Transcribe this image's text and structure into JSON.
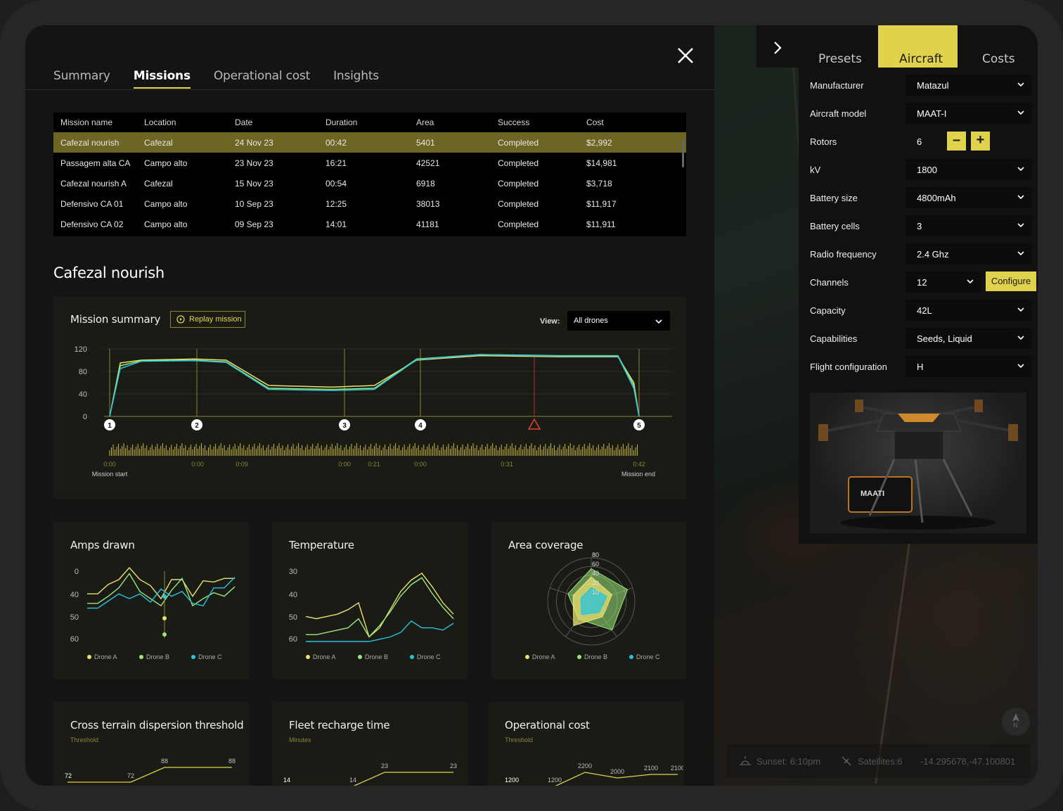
{
  "tabs": [
    "Summary",
    "Missions",
    "Operational cost",
    "Insights"
  ],
  "active_tab": "Missions",
  "table": {
    "headers": [
      "Mission name",
      "Location",
      "Date",
      "Duration",
      "Area",
      "Success",
      "Cost"
    ],
    "rows": [
      [
        "Cafezal nourish",
        "Cafezal",
        "24 Nov 23",
        "00:42",
        "5401",
        "Completed",
        "$2,992"
      ],
      [
        "Passagem alta CA",
        "Campo alto",
        "23 Nov 23",
        "16:21",
        "42521",
        "Completed",
        "$14,981"
      ],
      [
        "Cafezal nourish A",
        "Cafezal",
        "15 Nov 23",
        "00:54",
        "6918",
        "Completed",
        "$3,718"
      ],
      [
        "Defensivo CA 01",
        "Campo alto",
        "10 Sep 23",
        "12:25",
        "38013",
        "Completed",
        "$11,917"
      ],
      [
        "Defensivo CA 02",
        "Campo alto",
        "09 Sep 23",
        "14:01",
        "41181",
        "Completed",
        "$11,911"
      ]
    ]
  },
  "mission_title": "Cafezal nourish",
  "summary": {
    "title": "Mission summary",
    "replay_label": "Replay mission",
    "view_label": "View:",
    "view_value": "All drones",
    "time_labels": [
      "0:00",
      "0:00",
      "0:09",
      "0:00",
      "0:21",
      "0:00",
      "0:31",
      "0:42"
    ],
    "start_label": "Mission start",
    "end_label": "Mission end",
    "waypoints": [
      "1",
      "2",
      "3",
      "4",
      "5"
    ]
  },
  "cards": {
    "amps": "Amps drawn",
    "temperature": "Temperature",
    "area": "Area coverage",
    "cross": "Cross terrain dispersion threshold",
    "cross_sub": "Threshold",
    "fleet": "Fleet recharge time",
    "fleet_sub": "Minutes",
    "opcost": "Operational cost",
    "opcost_sub": "Threshold"
  },
  "legend": [
    "Drone A",
    "Drone B",
    "Drone C"
  ],
  "colors": {
    "accent": "#e0d24a",
    "droneA": "#e8e070",
    "droneB": "#9ae87a",
    "droneC": "#27c3e0",
    "selected_row": "#6d6524"
  },
  "chart_data": [
    {
      "type": "line",
      "title": "Mission summary",
      "ylim": [
        0,
        120
      ],
      "yticks": [
        0,
        40,
        80,
        120
      ],
      "x": [
        0,
        0.02,
        0.06,
        0.16,
        0.22,
        0.3,
        0.42,
        0.5,
        0.58,
        0.7,
        0.85,
        0.96,
        0.99,
        1.0
      ],
      "series": [
        {
          "name": "Drone A",
          "values": [
            0,
            95,
            100,
            102,
            100,
            55,
            52,
            55,
            100,
            108,
            106,
            106,
            60,
            0
          ]
        },
        {
          "name": "Drone B",
          "values": [
            0,
            90,
            99,
            100,
            97,
            50,
            48,
            50,
            102,
            110,
            108,
            108,
            55,
            0
          ]
        },
        {
          "name": "Drone C",
          "values": [
            0,
            85,
            98,
            99,
            96,
            48,
            46,
            48,
            101,
            110,
            107,
            107,
            50,
            0
          ]
        }
      ]
    },
    {
      "type": "line",
      "title": "Amps drawn",
      "ylim": [
        0,
        65
      ],
      "yticks": [
        0,
        40,
        50,
        60
      ],
      "series": [
        {
          "name": "Drone A",
          "values": [
            40,
            40,
            48,
            52,
            62,
            52,
            47,
            36,
            52,
            52,
            38,
            51,
            50,
            53,
            53
          ]
        },
        {
          "name": "Drone B",
          "values": [
            32,
            32,
            38,
            45,
            57,
            42,
            36,
            30,
            43,
            53,
            30,
            36,
            41,
            38,
            46
          ]
        },
        {
          "name": "Drone C",
          "values": [
            28,
            28,
            34,
            40,
            36,
            40,
            33,
            44,
            38,
            42,
            32,
            30,
            45,
            45,
            54
          ]
        }
      ]
    },
    {
      "type": "line",
      "title": "Temperature",
      "ylim": [
        28,
        62
      ],
      "yticks": [
        30,
        40,
        50,
        60
      ],
      "series": [
        {
          "name": "Drone A",
          "values": [
            39,
            38,
            39,
            40,
            42,
            45,
            30,
            34,
            42,
            50,
            55,
            58,
            52,
            45,
            40
          ]
        },
        {
          "name": "Drone B",
          "values": [
            31,
            31,
            32,
            33,
            34,
            38,
            30,
            35,
            41,
            48,
            53,
            56,
            49,
            43,
            38
          ]
        },
        {
          "name": "Drone C",
          "values": [
            28,
            28,
            28,
            28,
            28,
            28,
            28,
            29,
            30,
            32,
            37,
            34,
            34,
            33,
            36
          ]
        }
      ]
    },
    {
      "type": "radar",
      "title": "Area coverage",
      "rticks": [
        10,
        20,
        40,
        60,
        80
      ],
      "series": [
        {
          "name": "Drone A",
          "values": [
            45,
            40,
            35,
            55,
            35
          ]
        },
        {
          "name": "Drone B",
          "values": [
            60,
            70,
            65,
            40,
            45
          ]
        },
        {
          "name": "Drone C",
          "values": [
            25,
            30,
            25,
            30,
            20
          ]
        }
      ]
    },
    {
      "type": "line",
      "title": "Cross terrain dispersion threshold",
      "labels": [
        "72",
        "72",
        "88",
        "88"
      ],
      "values": [
        72,
        72,
        88,
        88
      ]
    },
    {
      "type": "line",
      "title": "Fleet recharge time",
      "labels": [
        "14",
        "14",
        "23",
        "23"
      ],
      "values": [
        14,
        14,
        23,
        23
      ]
    },
    {
      "type": "line",
      "title": "Operational cost",
      "labels": [
        "1200",
        "1200",
        "2200",
        "2000",
        "2100",
        "2100"
      ],
      "values": [
        1200,
        1200,
        2200,
        2000,
        2100,
        2100
      ]
    }
  ],
  "right_tabs": [
    "Presets",
    "Aircraft",
    "Costs"
  ],
  "right_active": "Aircraft",
  "aircraft": [
    {
      "label": "Manufacturer",
      "value": "Matazul"
    },
    {
      "label": "Aircraft model",
      "value": "MAAT-I"
    },
    {
      "label": "Rotors",
      "value": "6"
    },
    {
      "label": "kV",
      "value": "1800"
    },
    {
      "label": "Battery size",
      "value": "4800mAh"
    },
    {
      "label": "Battery cells",
      "value": "3"
    },
    {
      "label": "Radio frequency",
      "value": "2.4 Ghz"
    },
    {
      "label": "Channels",
      "value": "12"
    },
    {
      "label": "Capacity",
      "value": "42L"
    },
    {
      "label": "Capabilities",
      "value": "Seeds, Liquid"
    },
    {
      "label": "Flight configuration",
      "value": "H"
    }
  ],
  "configure_label": "Configure",
  "drone_brand": "MAATI",
  "status": {
    "sunset": "Sunset: 6:10pm",
    "satellites": "Satellites:6",
    "coords": "-14.295678,-47.100801"
  },
  "compass_label": "N"
}
